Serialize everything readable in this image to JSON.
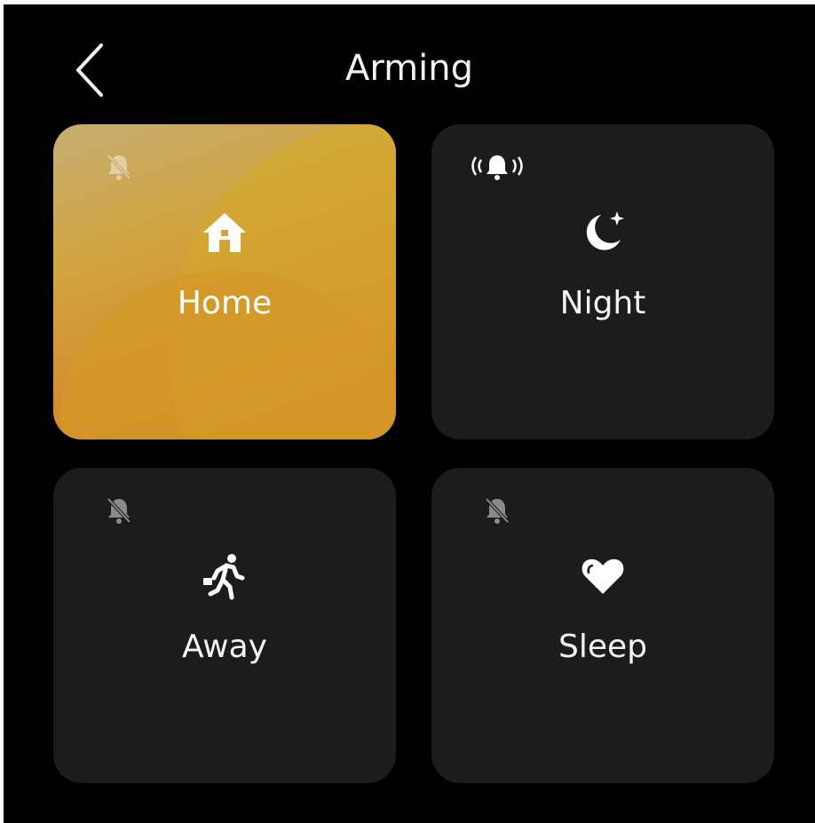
{
  "header": {
    "title": "Arming",
    "back_icon": "chevron-left-icon"
  },
  "modes": [
    {
      "label": "Home",
      "icon": "house-icon",
      "alert_icon": "bell-off-icon",
      "selected": true
    },
    {
      "label": "Night",
      "icon": "moon-star-icon",
      "alert_icon": "bell-ringing-icon",
      "selected": false
    },
    {
      "label": "Away",
      "icon": "running-person-icon",
      "alert_icon": "bell-off-icon",
      "selected": false
    },
    {
      "label": "Sleep",
      "icon": "heart-icon",
      "alert_icon": "bell-off-icon",
      "selected": false
    }
  ],
  "colors": {
    "background": "#000000",
    "tile": "#1c1c1c",
    "active_gradient_start": "#c6ad72",
    "active_gradient_end": "#c96b22",
    "text": "#f4f4f4"
  }
}
